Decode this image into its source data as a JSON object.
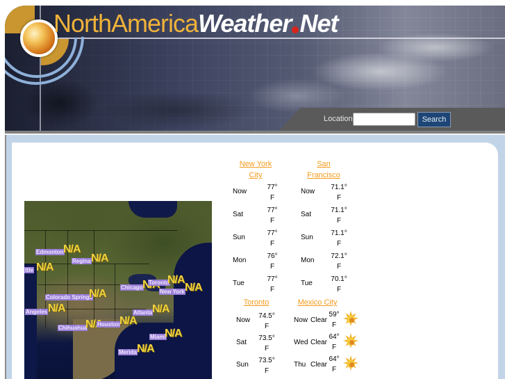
{
  "header": {
    "logo_light": "NorthAmerica",
    "logo_bold": "Weather",
    "logo_net": "Net",
    "search": {
      "label": "Location",
      "input_value": "",
      "button_label": "Search"
    }
  },
  "map": {
    "cities": [
      {
        "name": "Edmonton",
        "value": "N/A"
      },
      {
        "name": "Regina",
        "value": "N/A"
      },
      {
        "name": "Seattle",
        "label_visible": "ttle",
        "value": "N/A"
      },
      {
        "name": "Chicago",
        "value": "N/A"
      },
      {
        "name": "Toronto",
        "value": "N/A"
      },
      {
        "name": "New York",
        "value": "N/A"
      },
      {
        "name": "Colorado Springs",
        "value": "N/A"
      },
      {
        "name": "Los Angeles",
        "label_visible": "Angeles",
        "value": "N/A"
      },
      {
        "name": "Atlanta",
        "value": "N/A"
      },
      {
        "name": "Chihuahua",
        "value": "N/A"
      },
      {
        "name": "Houston",
        "value": "N/A"
      },
      {
        "name": "Miami",
        "value": "N/A"
      },
      {
        "name": "Merida",
        "value": "N/A"
      }
    ]
  },
  "forecasts": [
    {
      "city": "New York City",
      "city_line1": "New York",
      "city_line2": "City",
      "rows": [
        {
          "day": "Now",
          "temp": "77°",
          "unit": "F"
        },
        {
          "day": "Sat",
          "temp": "77°",
          "unit": "F"
        },
        {
          "day": "Sun",
          "temp": "77°",
          "unit": "F"
        },
        {
          "day": "Mon",
          "temp": "76°",
          "unit": "F"
        },
        {
          "day": "Tue",
          "temp": "77°",
          "unit": "F"
        }
      ]
    },
    {
      "city": "San Francisco",
      "city_line1": "San",
      "city_line2": "Francisco",
      "rows": [
        {
          "day": "Now",
          "temp": "71.1°",
          "unit": "F"
        },
        {
          "day": "Sat",
          "temp": "71.1°",
          "unit": "F"
        },
        {
          "day": "Sun",
          "temp": "71.1°",
          "unit": "F"
        },
        {
          "day": "Mon",
          "temp": "72.1°",
          "unit": "F"
        },
        {
          "day": "Tue",
          "temp": "70.1°",
          "unit": "F"
        }
      ]
    },
    {
      "city": "Toronto",
      "rows": [
        {
          "day": "Now",
          "temp": "74.5°",
          "unit": "F"
        },
        {
          "day": "Sat",
          "temp": "73.5°",
          "unit": "F"
        },
        {
          "day": "Sun",
          "temp": "73.5°",
          "unit": "F"
        }
      ]
    },
    {
      "city": "Mexico City",
      "rows": [
        {
          "day": "Now",
          "condition": "Clear",
          "temp": "59°",
          "unit": "F",
          "icon": "sun-icon"
        },
        {
          "day": "Wed",
          "condition": "Clear",
          "temp": "64°",
          "unit": "F",
          "icon": "sun-icon"
        },
        {
          "day": "Thu",
          "condition": "Clear",
          "temp": "64°",
          "unit": "F",
          "icon": "sun-icon"
        }
      ]
    }
  ],
  "colors": {
    "link": "#f39a1c",
    "logo_gold": "#f0b23a",
    "logo_dot": "#d8241b",
    "search_button": "#1d4676",
    "frame": "#c2d4e8"
  }
}
